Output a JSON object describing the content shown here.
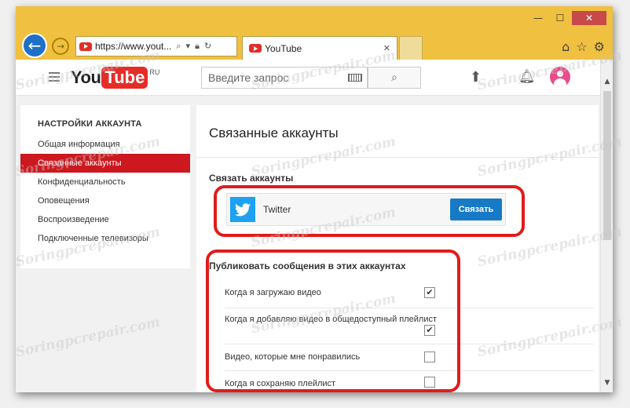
{
  "browser": {
    "address_text": "https://www.yout...",
    "tab_title": "YouTube",
    "back_label": "←",
    "forward_label": "→"
  },
  "youtube": {
    "logo_you": "You",
    "logo_tube": "Tube",
    "logo_region": "RU",
    "search_placeholder": "Введите запрос"
  },
  "sidebar": {
    "title": "НАСТРОЙКИ АККАУНТА",
    "items": [
      {
        "label": "Общая информация",
        "active": false
      },
      {
        "label": "Связанные аккаунты",
        "active": true
      },
      {
        "label": "Конфиденциальность",
        "active": false
      },
      {
        "label": "Оповещения",
        "active": false
      },
      {
        "label": "Воспроизведение",
        "active": false
      },
      {
        "label": "Подключенные телевизоры",
        "active": false
      }
    ]
  },
  "main": {
    "title": "Связанные аккаунты",
    "connect_section_title": "Связать аккаунты",
    "twitter_name": "Twitter",
    "connect_button": "Связать",
    "publish_section_title": "Публиковать сообщения в этих аккаунтах",
    "options": [
      {
        "label": "Когда я загружаю видео",
        "checked": true
      },
      {
        "label": "Когда я добавляю видео в общедоступный плейлист",
        "checked": true
      },
      {
        "label": "Видео, которые мне понравились",
        "checked": false
      },
      {
        "label": "Когда я сохраняю плейлист",
        "checked": false
      }
    ]
  },
  "watermark": "Soringpcrepair.com",
  "colors": {
    "window_frame": "#f0c040",
    "youtube_red": "#cc181e",
    "twitter_blue": "#1da1f2",
    "button_blue": "#167ac6",
    "annotation_red": "#e21b1b"
  }
}
